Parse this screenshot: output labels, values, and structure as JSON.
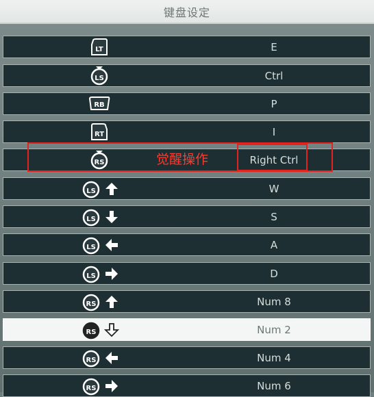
{
  "window": {
    "title": "键盘设定"
  },
  "annotation": {
    "label": "觉醒操作",
    "color": "#e3241e"
  },
  "rows": [
    {
      "button": "LT",
      "button_icon": "lt-trigger-icon",
      "direction": null,
      "key": "E"
    },
    {
      "button": "LS",
      "button_icon": "ls-press-icon",
      "direction": null,
      "key": "Ctrl"
    },
    {
      "button": "RB",
      "button_icon": "rb-bumper-icon",
      "direction": null,
      "key": "P"
    },
    {
      "button": "RT",
      "button_icon": "rt-trigger-icon",
      "direction": null,
      "key": "I"
    },
    {
      "button": "RS",
      "button_icon": "rs-press-icon",
      "direction": null,
      "key": "Right Ctrl"
    },
    {
      "button": "LS",
      "button_icon": "ls-stick-icon",
      "direction": "up",
      "key": "W"
    },
    {
      "button": "LS",
      "button_icon": "ls-stick-icon",
      "direction": "down",
      "key": "S"
    },
    {
      "button": "LS",
      "button_icon": "ls-stick-icon",
      "direction": "left",
      "key": "A"
    },
    {
      "button": "LS",
      "button_icon": "ls-stick-icon",
      "direction": "right",
      "key": "D"
    },
    {
      "button": "RS",
      "button_icon": "rs-stick-icon",
      "direction": "up",
      "key": "Num 8"
    },
    {
      "button": "RS",
      "button_icon": "rs-stick-icon",
      "direction": "down",
      "key": "Num 2",
      "selected": true
    },
    {
      "button": "RS",
      "button_icon": "rs-stick-icon",
      "direction": "left",
      "key": "Num 4"
    },
    {
      "button": "RS",
      "button_icon": "rs-stick-icon",
      "direction": "right",
      "key": "Num 6"
    }
  ]
}
